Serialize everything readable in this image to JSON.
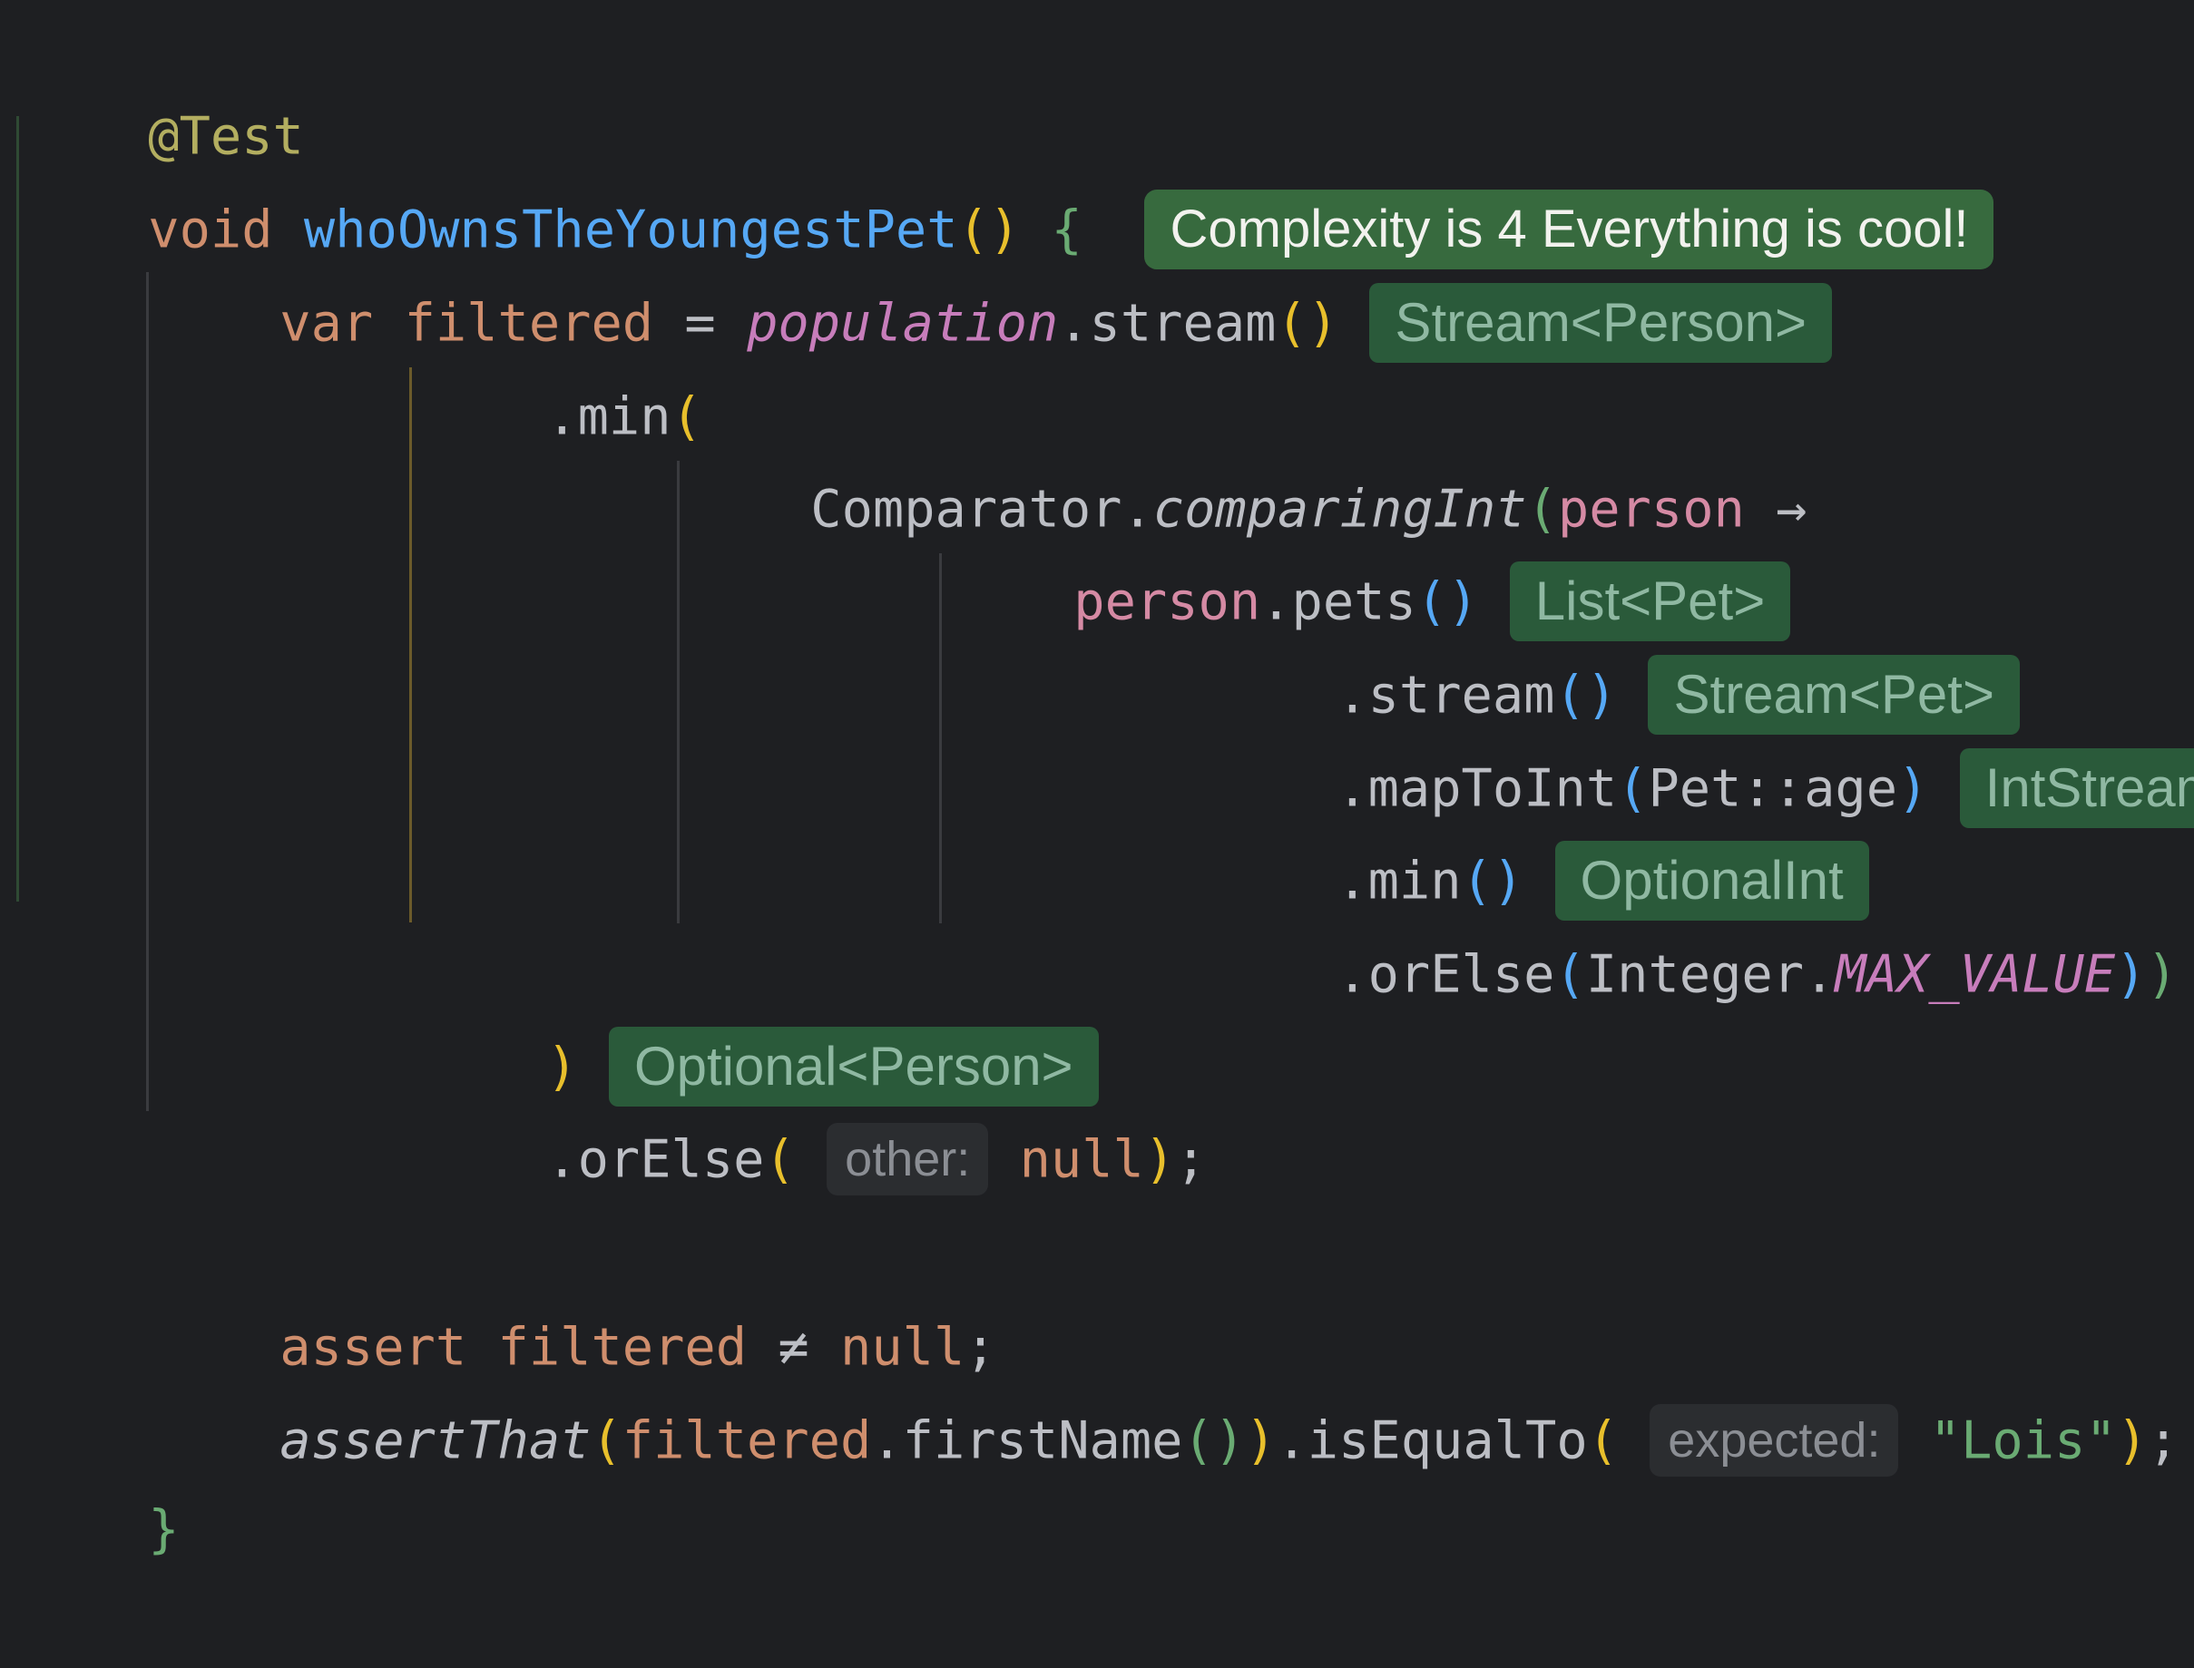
{
  "code": {
    "annotation": "@Test",
    "kw_void": "void",
    "method_name": "whoOwnsTheYoungestPet",
    "complexity_hint": "Complexity is 4 Everything is cool!",
    "kw_var": "var",
    "var_filtered": "filtered",
    "assign": " = ",
    "population": "population",
    "stream_call": ".stream",
    "hint_stream_person": "Stream<Person>",
    "min_call": ".min",
    "comparator": "Comparator.",
    "comparing_int": "comparingInt",
    "lambda_param": "person",
    "arrow": "→",
    "person_ref": "person",
    "pets_call": ".pets",
    "hint_list_pet": "List<Pet>",
    "hint_stream_pet": "Stream<Pet>",
    "map_to_int": ".mapToInt",
    "pet_ref": "Pet",
    "method_ref": "::",
    "age": "age",
    "hint_intstream": "IntStream",
    "hint_optionalint": "OptionalInt",
    "or_else": ".orElse",
    "integer": "Integer.",
    "max_value": "MAX_VALUE",
    "hint_optional_person": "Optional<Person>",
    "param_other": "other:",
    "null_kw": "null",
    "kw_assert": "assert",
    "not_equal": "≠",
    "assert_that": "assertThat",
    "first_name": ".firstName",
    "is_equal_to": ".isEqualTo",
    "param_expected": "expected:",
    "lois": "\"Lois\"",
    "semicolon": ";",
    "open_brace": "{",
    "close_brace": "}"
  },
  "colors": {
    "background": "#1e1f22",
    "keyword": "#cf8e6d",
    "method": "#56a8f5",
    "annotation": "#b3ae60",
    "field": "#c77dbb",
    "string": "#6aab73",
    "hint_bg": "#2a5a3a",
    "hint_text": "#8fb8a2"
  }
}
